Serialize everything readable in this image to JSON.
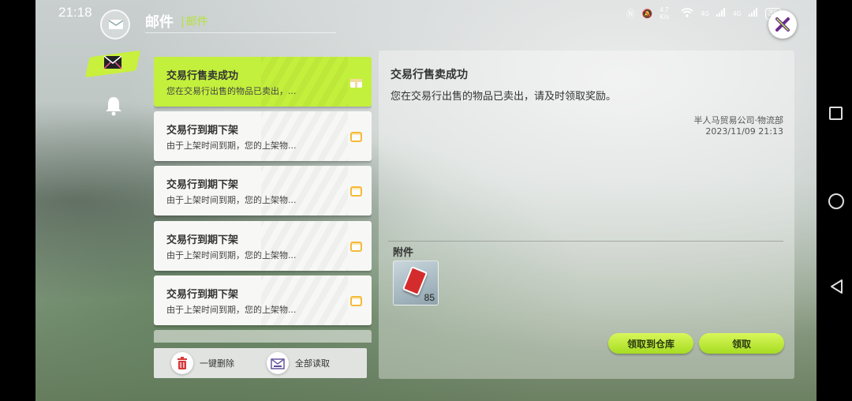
{
  "status_bar": {
    "time": "21:18",
    "net_speed": "4.7 K/s",
    "signal1": "4G",
    "signal2": "4G",
    "battery": "35"
  },
  "header": {
    "title": "邮件",
    "subtitle": "邮件"
  },
  "nav": {
    "items": [
      {
        "icon": "mail-icon",
        "active": true
      },
      {
        "icon": "bell-icon",
        "active": false
      }
    ]
  },
  "mail_list": {
    "items": [
      {
        "title": "交易行售卖成功",
        "preview": "您在交易行出售的物品已卖出，...",
        "active": true
      },
      {
        "title": "交易行到期下架",
        "preview": "由于上架时间到期，您的上架物...",
        "active": false
      },
      {
        "title": "交易行到期下架",
        "preview": "由于上架时间到期，您的上架物...",
        "active": false
      },
      {
        "title": "交易行到期下架",
        "preview": "由于上架时间到期，您的上架物...",
        "active": false
      },
      {
        "title": "交易行到期下架",
        "preview": "由于上架时间到期，您的上架物...",
        "active": false
      }
    ]
  },
  "bottom_bar": {
    "delete_all_label": "一键删除",
    "read_all_label": "全部读取"
  },
  "detail": {
    "title": "交易行售卖成功",
    "body": "您在交易行出售的物品已卖出，请及时领取奖励。",
    "sender": "半人马贸易公司·物流部",
    "date": "2023/11/09  21:13",
    "attachments_label": "附件",
    "attachment": {
      "icon": "red-card-icon",
      "quantity": "85"
    },
    "claim_to_warehouse_label": "领取到仓库",
    "claim_label": "领取"
  },
  "colors": {
    "accent": "#c3f03c",
    "header_sub": "#b6e23a",
    "close_x": "#6a2c8c"
  }
}
